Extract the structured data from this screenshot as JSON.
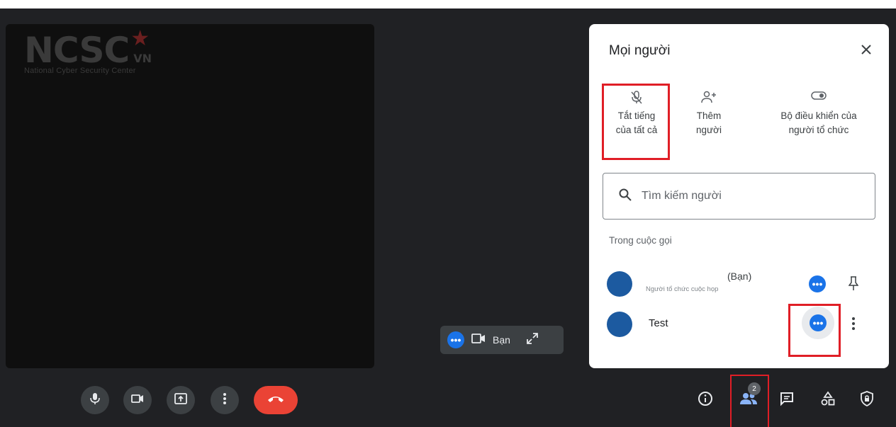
{
  "video": {
    "logo": {
      "text": "NCSC",
      "suffix": "VN",
      "tagline": "National Cyber Security Center"
    }
  },
  "self_view": {
    "label": "Bạn"
  },
  "people_panel": {
    "title": "Mọi người",
    "actions": [
      {
        "label_line1": "Tắt tiếng",
        "label_line2": "của tất cả",
        "icon": "mic-off-icon"
      },
      {
        "label_line1": "Thêm",
        "label_line2": "người",
        "icon": "add-person-icon"
      },
      {
        "label_line1": "Bộ điều khiển của",
        "label_line2": "người tổ chức",
        "icon": "toggle-icon"
      }
    ],
    "search": {
      "placeholder": "Tìm kiếm người"
    },
    "section_label": "Trong cuộc gọi",
    "participants": [
      {
        "name": "",
        "you_tag": "(Bạn)",
        "role": "Người tổ chức cuộc họp"
      },
      {
        "name": "Test"
      }
    ]
  },
  "toolbar": {
    "people_count": "2"
  },
  "colors": {
    "accent": "#1a73e8",
    "end_call": "#ea4335",
    "highlight": "#e01e26",
    "avatar": "#1c5aa0"
  }
}
